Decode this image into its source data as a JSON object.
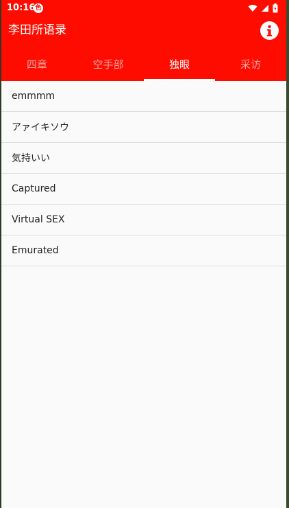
{
  "status_bar": {
    "time": "10:16",
    "app_badge": "色"
  },
  "toolbar": {
    "title": "李田所语录"
  },
  "tabs": [
    {
      "label": "四章",
      "active": false
    },
    {
      "label": "空手部",
      "active": false
    },
    {
      "label": "独眼",
      "active": true
    },
    {
      "label": "采访",
      "active": false
    }
  ],
  "list": {
    "items": [
      "emmmm",
      "アァイキソウ",
      "気持いい",
      "Captured",
      "Virtual SEX",
      "Emurated"
    ]
  },
  "colors": {
    "primary": "#ff0c00",
    "background": "#fafafa",
    "divider": "#dddddd"
  }
}
